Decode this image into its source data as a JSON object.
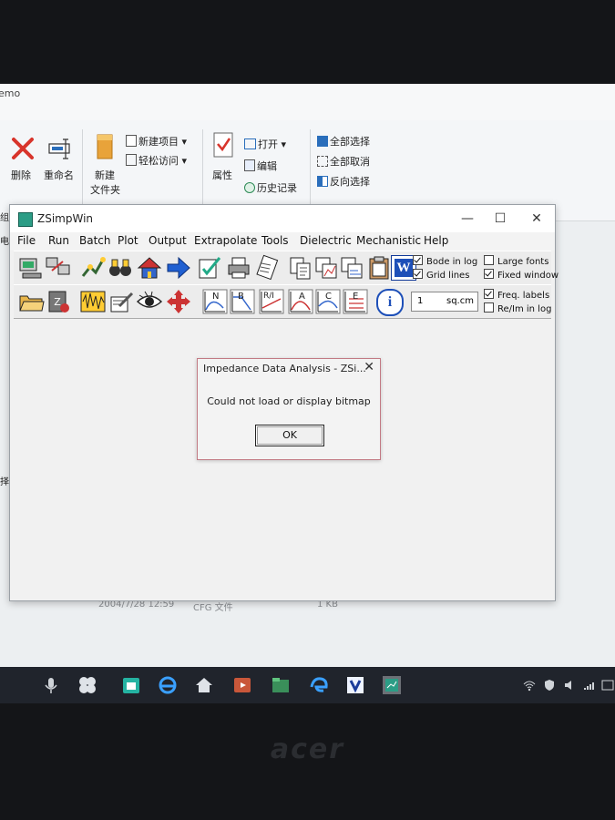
{
  "explorer": {
    "title_fragment": "emo",
    "ribbon": {
      "delete": "删除",
      "rename": "重命名",
      "new_folder_top": "新建",
      "new_folder_bottom": "文件夹",
      "new_item": "新建项目 ▾",
      "easy_access": "轻松访问 ▾",
      "properties": "属性",
      "open": "打开 ▾",
      "edit": "编辑",
      "history": "历史记录",
      "select_all": "全部选择",
      "select_none": "全部取消",
      "invert": "反向选择"
    },
    "left_fragments": [
      "组",
      "电",
      "择细使用"
    ],
    "file_row": {
      "date": "2004/7/28 12:59",
      "type": "CFG 文件",
      "size": "1 KB"
    }
  },
  "zsimpwin": {
    "title": "ZSimpWin",
    "controls": {
      "minimize": "—",
      "maximize": "☐",
      "close": "✕"
    },
    "menu": [
      "File",
      "Run",
      "Batch",
      "Plot",
      "Output",
      "Extrapolate",
      "Tools",
      "Dielectric",
      "Mechanistic",
      "Help"
    ],
    "options": {
      "bode_log": "Bode in log",
      "grid_lines": "Grid lines",
      "large_fonts": "Large fonts",
      "fixed_window": "Fixed window",
      "freq_labels": "Freq. labels",
      "re_im_log": "Re/Im in log"
    },
    "area": {
      "value": "1",
      "unit": "sq.cm"
    },
    "plot_buttons": [
      "N",
      "B",
      "R/I",
      "A",
      "C",
      "E"
    ],
    "word_label": "W",
    "info_label": "i"
  },
  "dialog": {
    "title": "Impedance Data Analysis - ZSi...",
    "close": "✕",
    "message": "Could not load or display bitmap",
    "ok": "OK"
  },
  "brand": "acer",
  "colors": {
    "accent": "#2c9d86",
    "dialog_border": "#c27a84",
    "taskbar": "#20242c"
  }
}
